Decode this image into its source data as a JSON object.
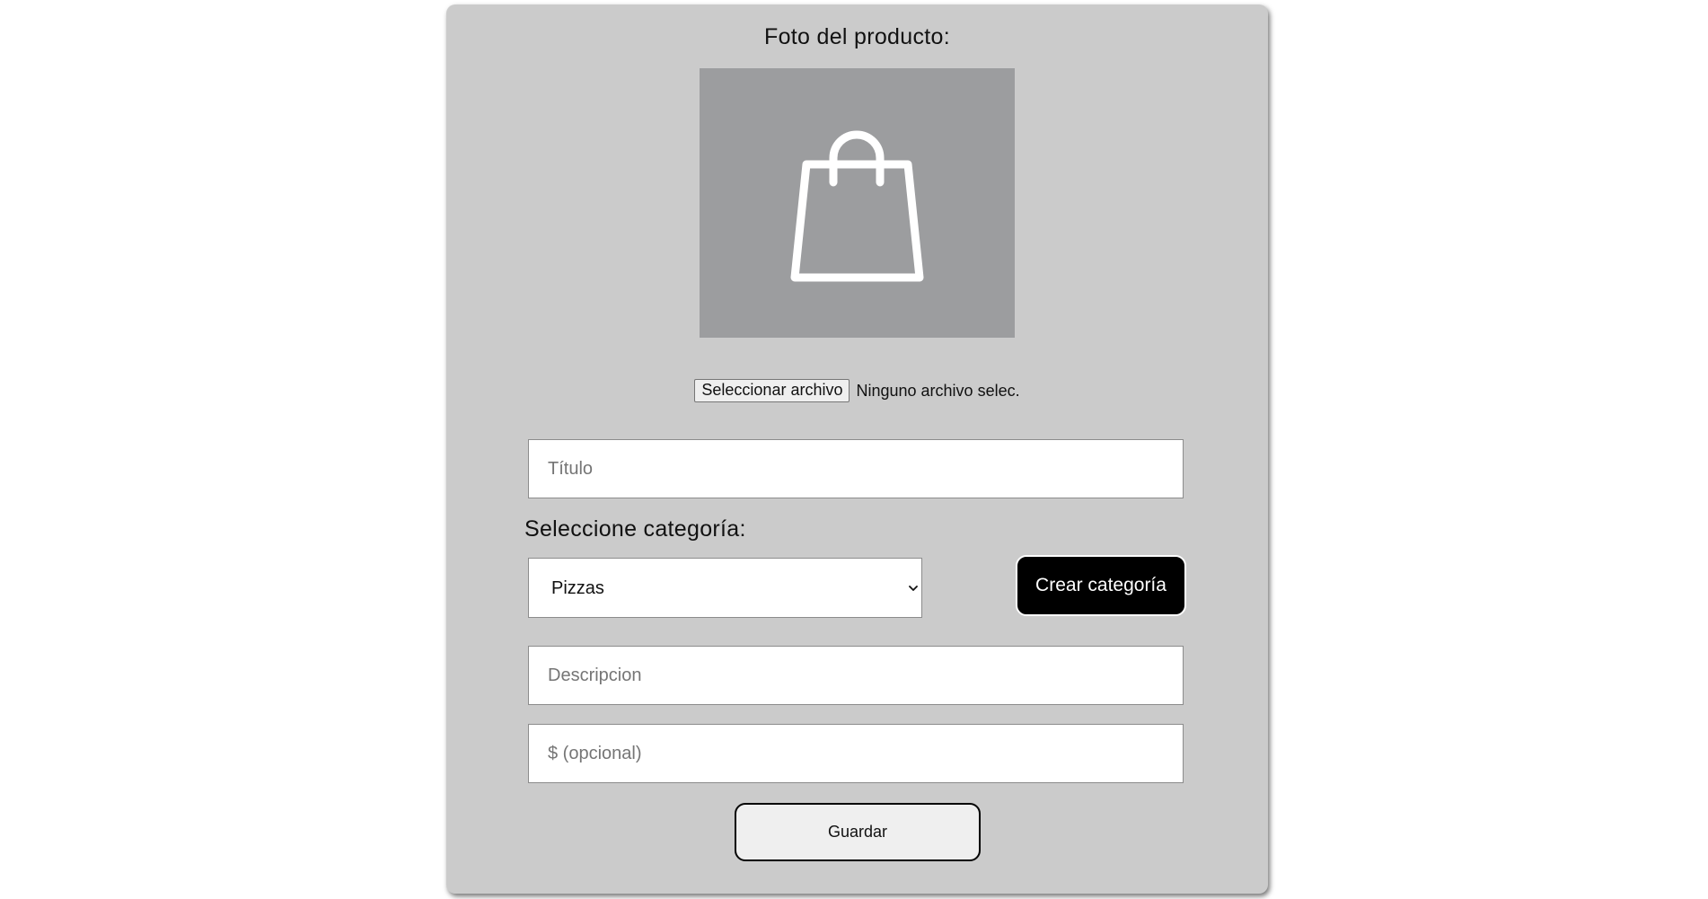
{
  "form": {
    "photo_label": "Foto del producto:",
    "photo_icon": "shopping-bag-icon",
    "file_button_label": "Seleccionar archivo",
    "file_status": "Ninguno archivo selec.",
    "title_placeholder": "Título",
    "category_label": "Seleccione categoría:",
    "category_selected": "Pizzas",
    "create_category_label": "Crear categoría",
    "description_placeholder": "Descripcion",
    "price_placeholder": "$ (opcional)",
    "save_label": "Guardar"
  },
  "colors": {
    "card_background": "#cbcbcb",
    "photo_placeholder_background": "#9c9d9f",
    "create_button_background": "#000000",
    "save_button_background": "#efefef"
  }
}
